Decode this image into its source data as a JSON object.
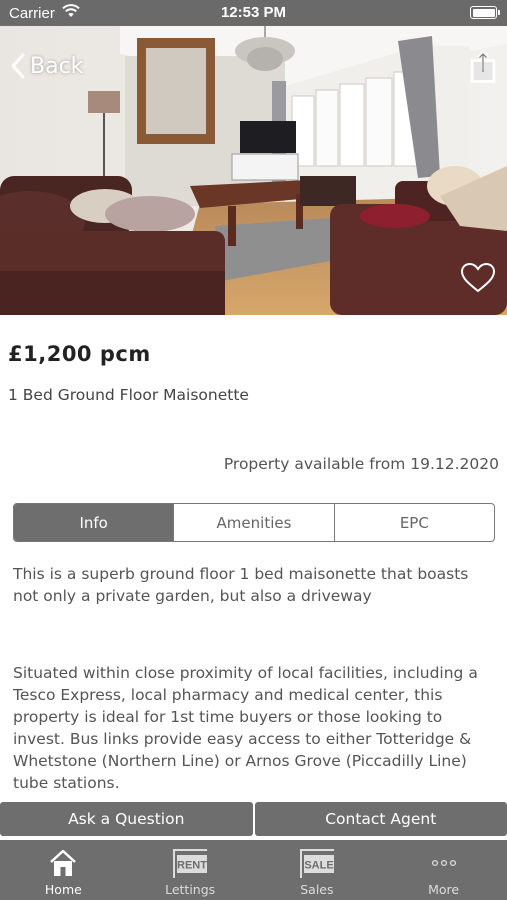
{
  "status_bar": {
    "carrier": "Carrier",
    "time": "12:53 PM"
  },
  "header": {
    "back_label": "Back"
  },
  "listing": {
    "price": "£1,200 pcm",
    "title": "1 Bed Ground Floor Maisonette",
    "availability": "Property available from 19.12.2020"
  },
  "tabs": [
    {
      "label": "Info",
      "active": true
    },
    {
      "label": "Amenities",
      "active": false
    },
    {
      "label": "EPC",
      "active": false
    }
  ],
  "description": {
    "paragraph_1": "This is a superb ground floor 1 bed maisonette that boasts not only a private garden, but also a driveway",
    "paragraph_2": "Situated within close proximity of local facilities, including a Tesco Express, local pharmacy and medical center, this property is ideal for 1st time buyers or those looking to invest. Bus links provide easy access to either Totteridge & Whetstone (Northern Line) or Arnos Grove (Piccadilly Line) tube stations."
  },
  "actions": {
    "ask_question": "Ask a Question",
    "contact_agent": "Contact Agent"
  },
  "tab_bar": {
    "items": [
      {
        "label": "Home",
        "icon": "home-icon",
        "active": true
      },
      {
        "label": "Lettings",
        "icon": "rent-sign-icon",
        "badge": "RENT"
      },
      {
        "label": "Sales",
        "icon": "sale-sign-icon",
        "badge": "SALE"
      },
      {
        "label": "More",
        "icon": "more-icon"
      }
    ]
  },
  "colors": {
    "bar_gray": "#6e6e6e",
    "status_gray": "#6a6a6a",
    "text": "#555555"
  }
}
